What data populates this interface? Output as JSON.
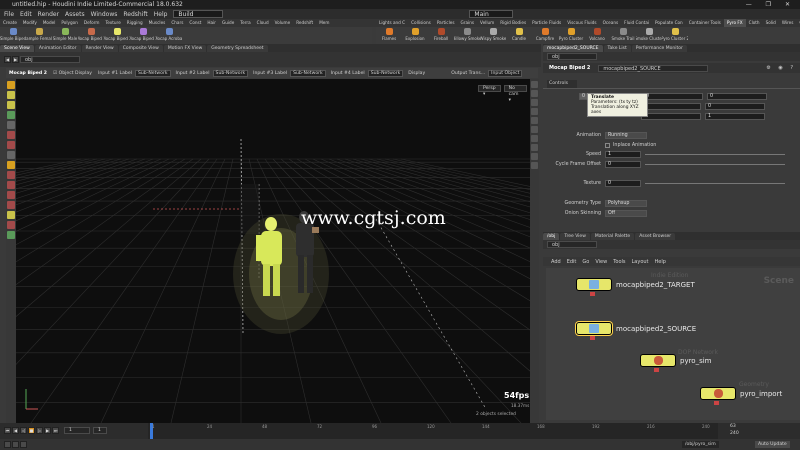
{
  "title_bar": {
    "title": "untitled.hip - Houdini Indie Limited-Commercial 18.0.632",
    "window_controls": "— ❐ ✕"
  },
  "menu": {
    "items": [
      "File",
      "Edit",
      "Render",
      "Assets",
      "Windows",
      "Redshift",
      "Help"
    ],
    "desktop": "Build",
    "main_label": "Main"
  },
  "shelf_tabs_left": [
    "Create",
    "Modify",
    "Model",
    "Polygon",
    "Deform",
    "Texture",
    "Rigging",
    "Muscles",
    "Chars",
    "Const",
    "Hair",
    "Guide",
    "Terra",
    "Cloud",
    "Volume",
    "Redshift",
    "Mem"
  ],
  "shelf_tabs_right": [
    "Lights and C",
    "Collisions",
    "Particles",
    "Grains",
    "Vellum",
    "Rigid Bodies",
    "Particle Fluids",
    "Viscous Fluids",
    "Oceans",
    "Fluid Contai",
    "Populate Con",
    "Container Tools",
    "Pyro FX",
    "Cloth",
    "Solid",
    "Wires",
    "Crowds",
    "Drive Simula"
  ],
  "active_shelf_tab_right": "Pyro FX",
  "shelf_tools_left": [
    "Simple Biped",
    "Sample Female",
    "Simple Male",
    "Mocap Biped 1",
    "Mocap Biped 2",
    "Mocap Biped 3",
    "Mocap Acrobat"
  ],
  "shelf_tools_right": [
    "Flames",
    "Explosion",
    "Fireball",
    "Billowy Smoke",
    "Wispy Smoke",
    "Candle",
    "Campfire",
    "Pyro Cluster",
    "Volcano",
    "Smoke Trail",
    "Smoke Cluster",
    "Pyro Cluster 2"
  ],
  "left_pane": {
    "tabs": [
      "Scene View",
      "Animation Editor",
      "Render View",
      "Composite View",
      "Motion FX View",
      "Geometry Spreadsheet"
    ],
    "active_tab": "Scene View",
    "path": "obj",
    "node_type": "Mocap Biped 2",
    "object_display": "Object Display",
    "input_labels": [
      "Input #1 Label",
      "Sub-Network",
      "Input #2 Label",
      "Sub-Network",
      "Input #3 Label",
      "Sub-Network",
      "Input #4 Label",
      "Sub-Network"
    ],
    "display_label": "Display",
    "output_label": "Output Trans...",
    "input_obj_label": "Input Object",
    "persp": "Persp ▾",
    "cam": "No cam ▾",
    "fps": "54fps",
    "fps_sub": "18.37ms",
    "selection_info": "2 objects selected",
    "watermark": "www.cgtsj.com"
  },
  "param_pane": {
    "tabs": [
      "mocapbiped2_SOURCE",
      "Take List",
      "Performance Monitor"
    ],
    "path": "obj",
    "node_type": "Mocap Biped 2",
    "node_name": "mocapbiped2_SOURCE",
    "section": "Controls",
    "tooltip": {
      "title": "Translate",
      "lines": [
        "Parameters: (tx ty tz)",
        "Translation along XYZ axes"
      ]
    },
    "translate": [
      "0",
      "0",
      "0"
    ],
    "rotate": [
      "0",
      "0",
      "0"
    ],
    "scale": [
      "1",
      "1",
      "1"
    ],
    "animation_label": "Animation",
    "animation_value": "Running",
    "inplace_label": "Inplace Animation",
    "speed_label": "Speed",
    "speed_value": "1",
    "cycle_label": "Cycle Frame Offset",
    "cycle_value": "0",
    "texture_label": "Texture",
    "texture_value": "0",
    "geo_type_label": "Geometry Type",
    "geo_type_value": "Polyhsup",
    "onion_label": "Onion Skinning",
    "onion_value": "Off"
  },
  "network_pane": {
    "tabs": [
      "/obj",
      "Tree View",
      "Material Palette",
      "Asset Browser"
    ],
    "path": "obj",
    "menu": [
      "Add",
      "Edit",
      "Go",
      "View",
      "Tools",
      "Layout",
      "Help"
    ],
    "context_label": "Scene",
    "watermark_labels": [
      "Indie Edition",
      "DOP Network",
      "Geometry"
    ],
    "nodes": [
      {
        "name": "mocapbiped2_TARGET",
        "color": "#e6e66a",
        "flag": "#cc4444"
      },
      {
        "name": "mocapbiped2_SOURCE",
        "color": "#e6e66a",
        "flag": "#cc4444"
      },
      {
        "name": "pyro_sim",
        "color": "#e6e66a",
        "flag": "#cc4444"
      },
      {
        "name": "pyro_import",
        "color": "#e6e66a",
        "flag": "#cc4444"
      }
    ]
  },
  "timeline": {
    "current_frame": "1",
    "start": "1",
    "ticks": [
      "1",
      "24",
      "48",
      "72",
      "96",
      "120",
      "144",
      "168",
      "192",
      "216",
      "240"
    ],
    "end_frame": "63",
    "range_end": "240"
  },
  "status": {
    "file": "/obj/pyro_sim",
    "auto_update": "Auto Update"
  },
  "colors": {
    "accent": "#f0a020",
    "node_yellow": "#e6e66a",
    "grid": "#3a3a3a"
  }
}
